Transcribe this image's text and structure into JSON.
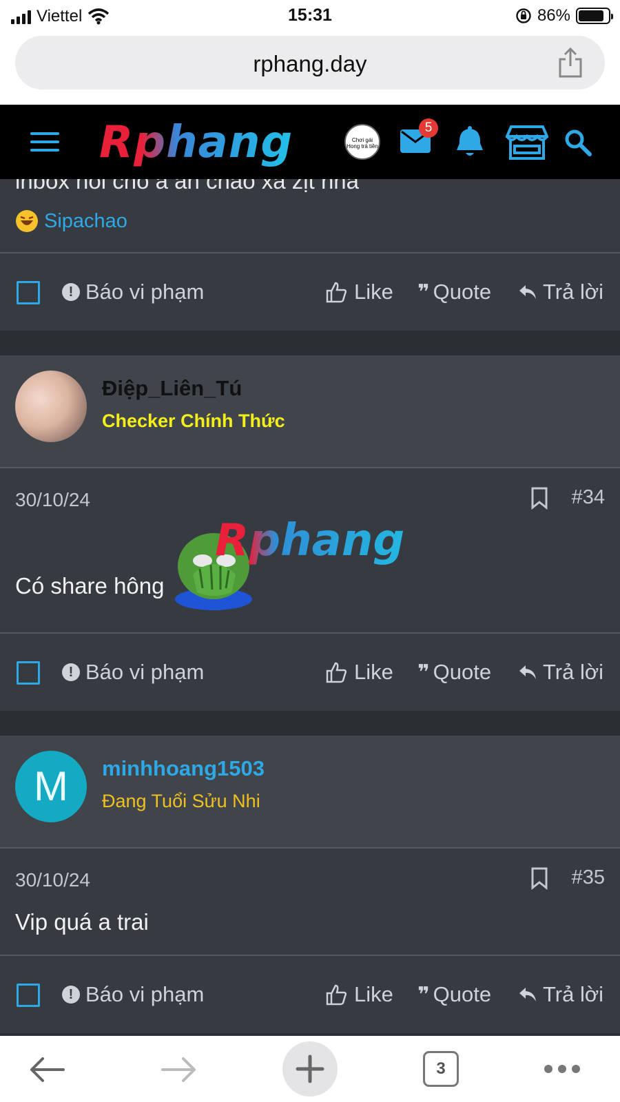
{
  "status_bar": {
    "carrier": "Viettel",
    "time": "15:31",
    "battery": "86%",
    "battery_level": 0.86
  },
  "browser": {
    "url": "rphang.day",
    "tab_count": "3"
  },
  "site_header": {
    "logo": "Rphang",
    "header_avatar_text": "Chơi gái Hong trả tiền",
    "mail_badge": "5"
  },
  "previous_post": {
    "text_fragment": "inbox hỏi cho a ăn cháo xả zịt nha",
    "reaction_user": "Sipachao"
  },
  "actions": {
    "report": "Báo vi phạm",
    "like": "Like",
    "quote": "Quote",
    "reply": "Trả lời"
  },
  "posts": [
    {
      "username": "Điệp_Liên_Tú",
      "user_title": "Checker Chính Thức",
      "date": "30/10/24",
      "number": "#34",
      "text": "Có share hông",
      "sticker_watermark": "Rphang"
    },
    {
      "username": "minhhoang1503",
      "avatar_letter": "M",
      "user_title": "Đang Tuổi Sửu Nhi",
      "date": "30/10/24",
      "number": "#35",
      "text": "Vip quá a trai"
    }
  ],
  "colors": {
    "accent": "#2fa8e6",
    "checker_title": "#f4ef1c",
    "sửu_nhi_title": "#f0c020",
    "avatar_teal": "#14aac3"
  }
}
